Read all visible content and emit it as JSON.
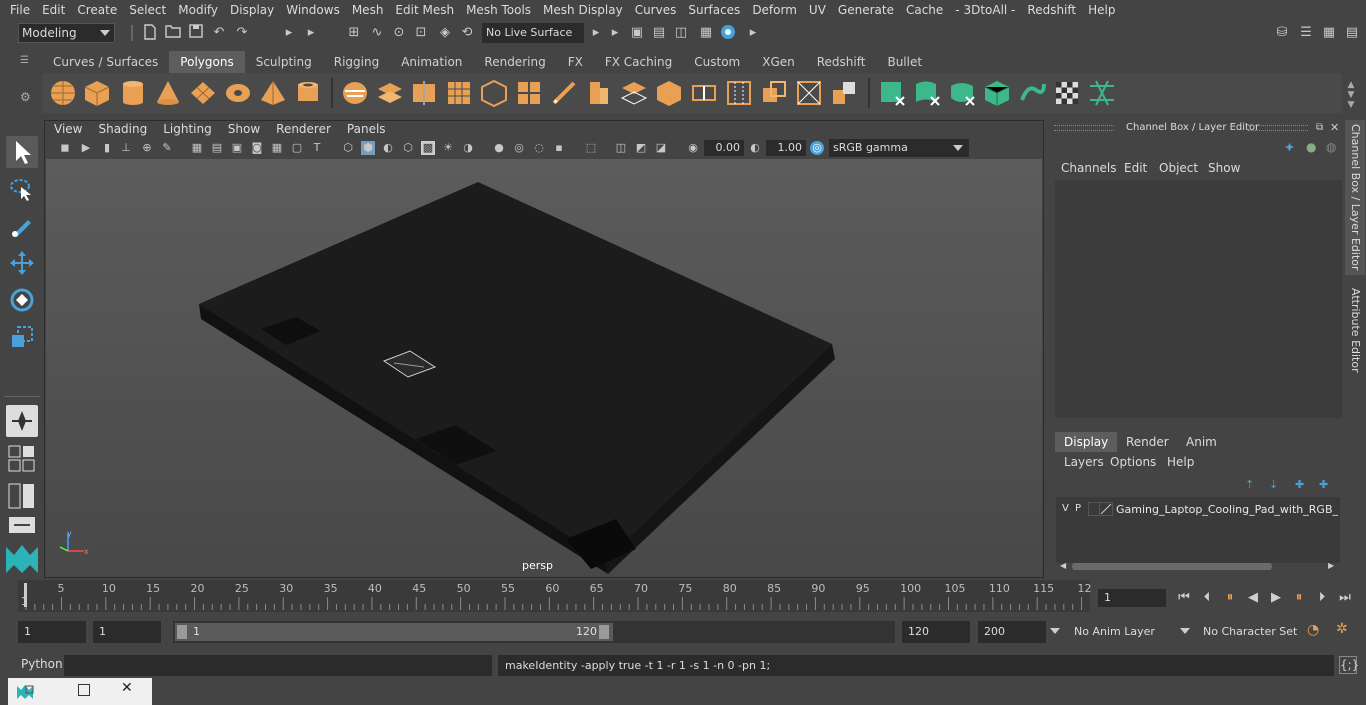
{
  "menubar": {
    "items": [
      "File",
      "Edit",
      "Create",
      "Select",
      "Modify",
      "Display",
      "Windows",
      "Mesh",
      "Edit Mesh",
      "Mesh Tools",
      "Mesh Display",
      "Curves",
      "Surfaces",
      "Deform",
      "UV",
      "Generate",
      "Cache",
      "- 3DtoAll -",
      "Redshift",
      "Help"
    ]
  },
  "statusline": {
    "mode": "Modeling",
    "live_surface": "No Live Surface"
  },
  "shelf": {
    "tabs": [
      "Curves / Surfaces",
      "Polygons",
      "Sculpting",
      "Rigging",
      "Animation",
      "Rendering",
      "FX",
      "FX Caching",
      "Custom",
      "XGen",
      "Redshift",
      "Bullet"
    ],
    "active_tab": "Polygons"
  },
  "viewport": {
    "menu": [
      "View",
      "Shading",
      "Lighting",
      "Show",
      "Renderer",
      "Panels"
    ],
    "exposure": "0.00",
    "gamma_value": "1.00",
    "color_space": "sRGB gamma",
    "camera_label": "persp"
  },
  "channelbox": {
    "title": "Channel Box / Layer Editor",
    "menu": [
      "Channels",
      "Edit",
      "Object",
      "Show"
    ],
    "tabs": [
      "Display",
      "Render",
      "Anim"
    ],
    "active_tab": "Display",
    "layer_menu": [
      "Layers",
      "Options",
      "Help"
    ],
    "layer": {
      "v": "V",
      "p": "P",
      "name": "Gaming_Laptop_Cooling_Pad_with_RGB_Lig"
    },
    "side_tabs": [
      "Channel Box / Layer Editor",
      "Attribute Editor"
    ]
  },
  "timeslider": {
    "ticks": [
      "5",
      "10",
      "15",
      "20",
      "25",
      "30",
      "35",
      "40",
      "45",
      "50",
      "55",
      "60",
      "65",
      "70",
      "75",
      "80",
      "85",
      "90",
      "95",
      "100",
      "105",
      "110",
      "115",
      "12"
    ],
    "start_label": "1",
    "current_frame": "1"
  },
  "range": {
    "start": "1",
    "current": "1",
    "range_start_label": "1",
    "range_end_label": "120",
    "end": "120",
    "max_end": "200",
    "anim_layer": "No Anim Layer",
    "character_set": "No Character Set"
  },
  "commandline": {
    "language": "Python",
    "output": "makeIdentity -apply true -t 1 -r 1 -s 1 -n 0 -pn 1;"
  },
  "colors": {
    "accent_blue": "#5a9fd6",
    "poly_orange": "#e8a055",
    "poly_green": "#3cb88a"
  }
}
